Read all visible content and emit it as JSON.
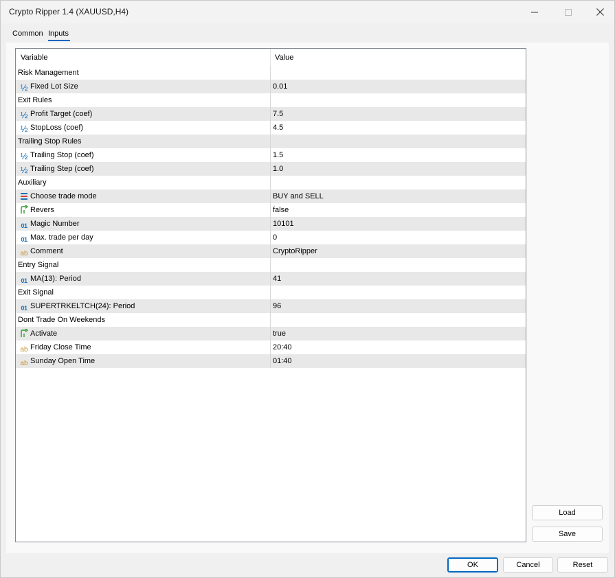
{
  "window": {
    "title": "Crypto Ripper 1.4 (XAUUSD,H4)"
  },
  "tabs": [
    {
      "label": "Common",
      "active": false
    },
    {
      "label": "Inputs",
      "active": true
    }
  ],
  "grid": {
    "headers": {
      "variable": "Variable",
      "value": "Value"
    },
    "rows": [
      {
        "type": "group",
        "label": "Risk Management",
        "value": ""
      },
      {
        "type": "param",
        "icon": "fraction-icon",
        "label": "Fixed Lot Size",
        "value": "0.01"
      },
      {
        "type": "group",
        "label": "Exit Rules",
        "value": ""
      },
      {
        "type": "param",
        "icon": "fraction-icon",
        "label": "Profit Target (coef)",
        "value": "7.5"
      },
      {
        "type": "param",
        "icon": "fraction-icon",
        "label": "StopLoss (coef)",
        "value": "4.5"
      },
      {
        "type": "group",
        "label": "Trailing Stop Rules",
        "value": ""
      },
      {
        "type": "param",
        "icon": "fraction-icon",
        "label": "Trailing Stop (coef)",
        "value": "1.5"
      },
      {
        "type": "param",
        "icon": "fraction-icon",
        "label": "Trailing Step (coef)",
        "value": "1.0"
      },
      {
        "type": "group",
        "label": "Auxiliary",
        "value": ""
      },
      {
        "type": "param",
        "icon": "enum-list-icon",
        "label": "Choose trade mode",
        "value": "BUY and SELL"
      },
      {
        "type": "param",
        "icon": "bool-arrow-icon",
        "label": "Revers",
        "value": "false"
      },
      {
        "type": "param",
        "icon": "integer-icon",
        "label": "Magic Number",
        "value": "10101"
      },
      {
        "type": "param",
        "icon": "integer-icon",
        "label": "Max. trade per day",
        "value": "0"
      },
      {
        "type": "param",
        "icon": "string-icon",
        "label": "Comment",
        "value": "CryptoRipper"
      },
      {
        "type": "group",
        "label": "Entry Signal",
        "value": ""
      },
      {
        "type": "param",
        "icon": "integer-icon",
        "label": "MA(13): Period",
        "value": "41"
      },
      {
        "type": "group",
        "label": "Exit Signal",
        "value": ""
      },
      {
        "type": "param",
        "icon": "integer-icon",
        "label": "SUPERTRKELTCH(24): Period",
        "value": "96"
      },
      {
        "type": "group",
        "label": "Dont Trade On Weekends",
        "value": ""
      },
      {
        "type": "param",
        "icon": "bool-arrow-icon",
        "label": "Activate",
        "value": "true"
      },
      {
        "type": "param",
        "icon": "string-icon",
        "label": "Friday Close Time",
        "value": "20:40"
      },
      {
        "type": "param",
        "icon": "string-icon",
        "label": "Sunday Open Time",
        "value": "01:40"
      }
    ]
  },
  "buttons": {
    "load": "Load",
    "save": "Save",
    "ok": "OK",
    "cancel": "Cancel",
    "reset": "Reset"
  },
  "colors": {
    "accent": "#0067c0",
    "alt_row": "#e8e8e8"
  }
}
